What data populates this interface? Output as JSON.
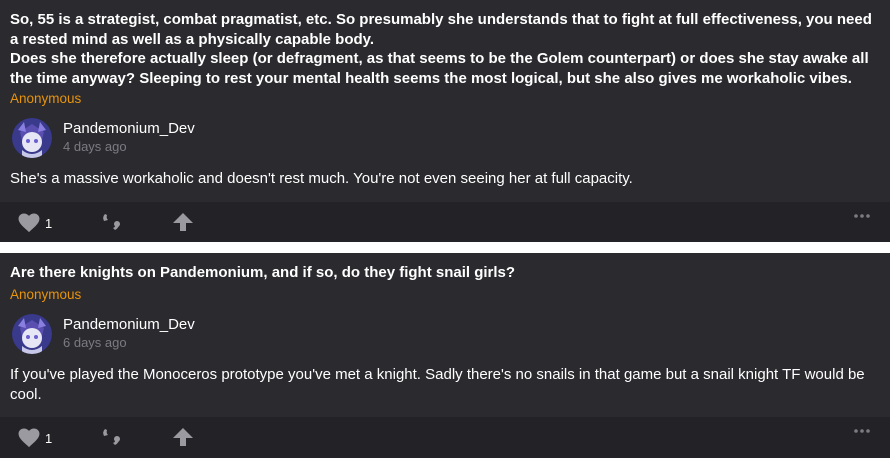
{
  "posts": [
    {
      "question": "So, 55 is a strategist, combat pragmatist, etc. So presumably she understands that to fight at full effectiveness, you need a rested mind as well as a physically capable body.\nDoes she therefore actually sleep (or defragment, as that seems to be the Golem counterpart) or does she stay awake all the time anyway? Sleeping to rest your mental health seems the most logical, but she also gives me workaholic vibes.",
      "asker": "Anonymous",
      "author": "Pandemonium_Dev",
      "time": "4 days ago",
      "answer": "She's a massive workaholic and doesn't rest much. You're not even seeing her at full capacity.",
      "likes": "1"
    },
    {
      "question": "Are there knights on Pandemonium, and if so, do they fight snail girls?",
      "asker": "Anonymous",
      "author": "Pandemonium_Dev",
      "time": "6 days ago",
      "answer": "If you've played the Monoceros prototype you've met a knight. Sadly there's no snails in that game but a snail knight TF would be cool.",
      "likes": "1"
    }
  ],
  "icons": {
    "like": "heart-icon",
    "quote": "quote-icon",
    "share": "share-arrow-icon",
    "more": "more-dots-icon",
    "avatar": "profile-avatar"
  },
  "colors": {
    "card_bg": "#2a2a2f",
    "actions_bg": "#232327",
    "asker": "#e8940c",
    "time": "#7b7b82",
    "icon": "#9a9aa0"
  }
}
